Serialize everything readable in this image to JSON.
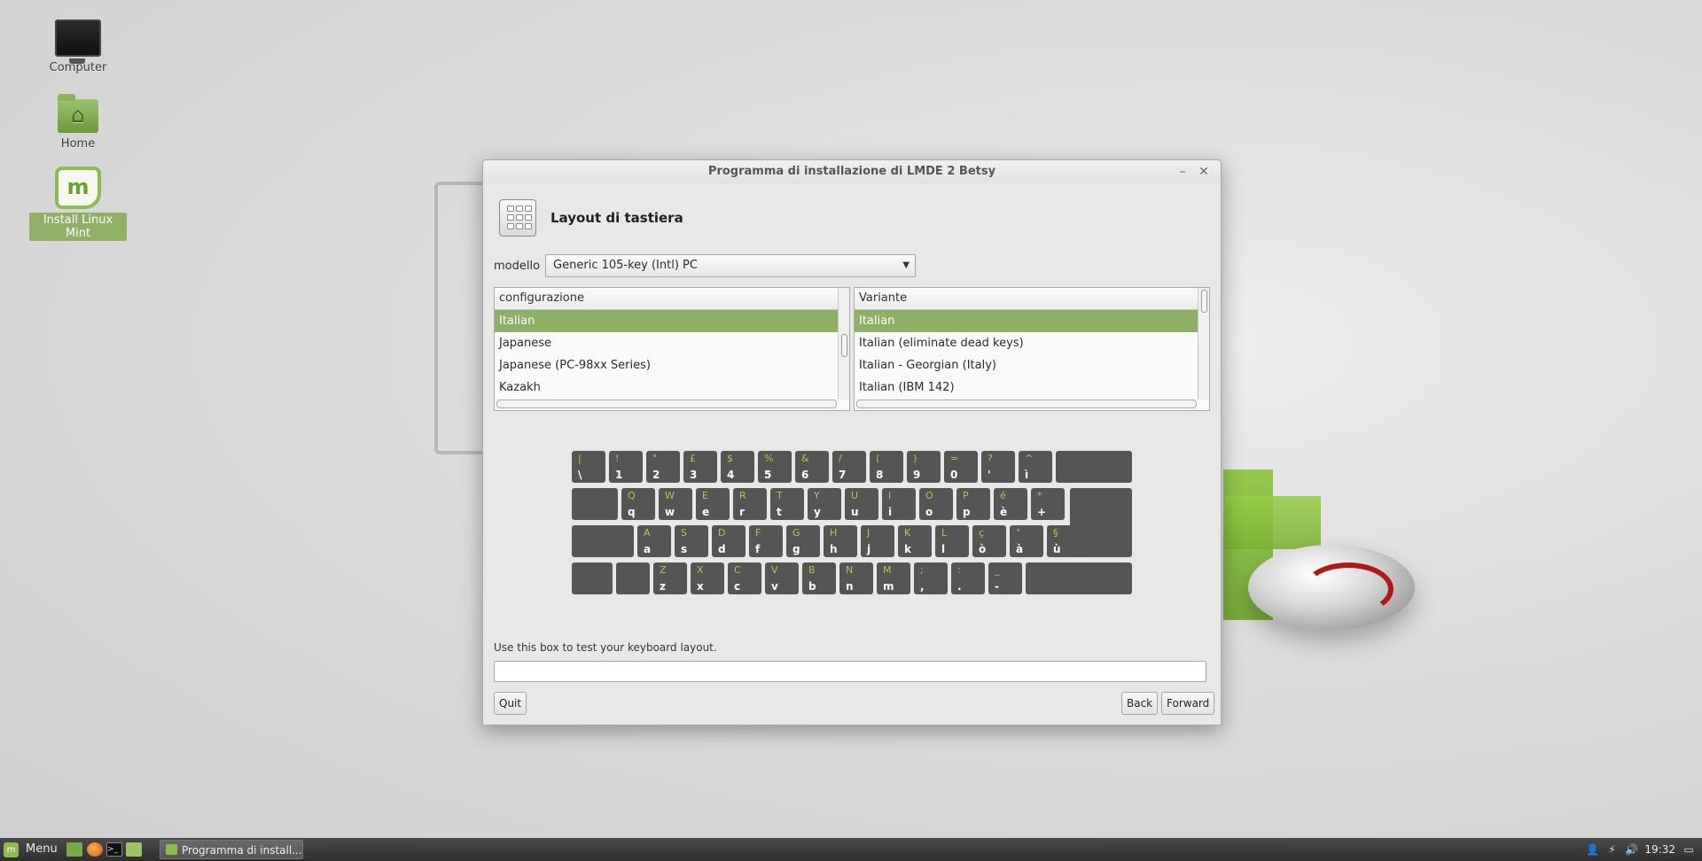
{
  "desktop": {
    "icons": [
      {
        "label": "Computer"
      },
      {
        "label": "Home"
      },
      {
        "label": "Install Linux Mint"
      }
    ]
  },
  "window": {
    "title": "Programma di installazione di LMDE 2 Betsy",
    "minimize_symbol": "–",
    "close_symbol": "✕",
    "header_title": "Layout di tastiera",
    "model_label": "modello",
    "model_value": "Generic 105-key (Intl) PC",
    "config_list": {
      "header": "configurazione",
      "rows": [
        "Italian",
        "Japanese",
        "Japanese (PC-98xx Series)",
        "Kazakh"
      ],
      "selected": "Italian"
    },
    "variant_list": {
      "header": "Variante",
      "rows": [
        "Italian",
        "Italian (eliminate dead keys)",
        "Italian - Georgian (Italy)",
        "Italian (IBM 142)"
      ],
      "selected": "Italian"
    },
    "keyboard": {
      "row1": [
        [
          "|",
          "\\"
        ],
        [
          "!",
          "1"
        ],
        [
          "\"",
          "2"
        ],
        [
          "£",
          "3"
        ],
        [
          "$",
          "4"
        ],
        [
          "%",
          "5"
        ],
        [
          "&",
          "6"
        ],
        [
          "/",
          "7"
        ],
        [
          "(",
          "8"
        ],
        [
          ")",
          "9"
        ],
        [
          "=",
          "0"
        ],
        [
          "?",
          "'"
        ],
        [
          "^",
          "ì"
        ]
      ],
      "row2": [
        [
          "Q",
          "q"
        ],
        [
          "W",
          "w"
        ],
        [
          "E",
          "e"
        ],
        [
          "R",
          "r"
        ],
        [
          "T",
          "t"
        ],
        [
          "Y",
          "y"
        ],
        [
          "U",
          "u"
        ],
        [
          "I",
          "i"
        ],
        [
          "O",
          "o"
        ],
        [
          "P",
          "p"
        ],
        [
          "é",
          "è"
        ],
        [
          "*",
          "+"
        ]
      ],
      "row3": [
        [
          "A",
          "a"
        ],
        [
          "S",
          "s"
        ],
        [
          "D",
          "d"
        ],
        [
          "F",
          "f"
        ],
        [
          "G",
          "g"
        ],
        [
          "H",
          "h"
        ],
        [
          "J",
          "j"
        ],
        [
          "K",
          "k"
        ],
        [
          "L",
          "l"
        ],
        [
          "ç",
          "ò"
        ],
        [
          "°",
          "à"
        ],
        [
          "§",
          "ù"
        ]
      ],
      "row4": [
        [
          "Z",
          "z"
        ],
        [
          "X",
          "x"
        ],
        [
          "C",
          "c"
        ],
        [
          "V",
          "v"
        ],
        [
          "B",
          "b"
        ],
        [
          "N",
          "n"
        ],
        [
          "M",
          "m"
        ],
        [
          ";",
          ","
        ],
        [
          ":",
          "."
        ],
        [
          "_",
          "-"
        ]
      ],
      "colors": {
        "shifted": "#9bd24b",
        "base": "#ffffff",
        "key": "#555555"
      }
    },
    "test_label": "Use this box to test your keyboard layout.",
    "test_value": "",
    "buttons": {
      "quit": "Quit",
      "back": "Back",
      "forward": "Forward"
    }
  },
  "taskbar": {
    "menu_label": "Menu",
    "launchers": [
      "show-desktop-icon",
      "firefox-icon",
      "terminal-icon",
      "files-icon"
    ],
    "task_item": "Programma di install...",
    "tray_icons": [
      "user-icon",
      "network-icon",
      "volume-icon"
    ],
    "clock": "19:32"
  },
  "colors": {
    "accent": "#8daf66",
    "mint_green": "#8dbb4f"
  }
}
